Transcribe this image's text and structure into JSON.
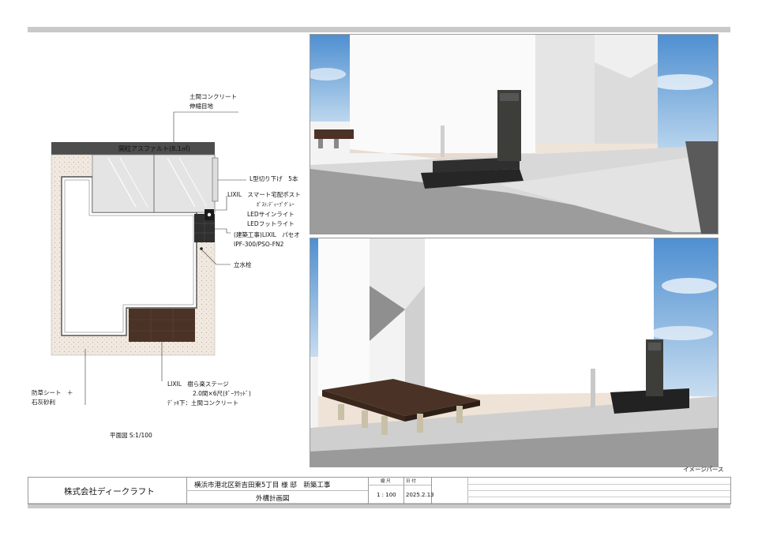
{
  "plan": {
    "asphalt_label": "開粒アスファルト(8.1㎡)",
    "callouts": {
      "concrete": [
        "土間コンクリート",
        "伸縮目地"
      ],
      "lcut": "L型切り下げ　5本",
      "post": [
        "LIXIL　スマート宅配ポスト",
        "ﾎﾟｽﾄ;ﾃﾞｨｰﾌﾟｸﾞﾚｰ",
        "LEDサインライト",
        "LEDフットライト"
      ],
      "paving": [
        "(建築工事)LIXIL　パセオ",
        "IPF-300/PSO-FN2"
      ],
      "faucet": "立水栓",
      "deck": [
        "LIXIL　樹ら楽ステージ",
        "2.0間×6尺(ﾀﾞｰｸｳｯﾄﾞ)",
        "ﾃﾞｯｷ下：土間コンクリート"
      ],
      "gravel": [
        "防草シート　＋",
        "石灰砂利"
      ]
    },
    "scale": "平面図 S:1/100"
  },
  "perspective_caption": "イメージパース",
  "title_block": {
    "company": "株式会社ディークラフト",
    "project": "横浜市港北区新吉田東5丁目 様 邸　新築工事",
    "drawing_name": "外構計画図",
    "scale_header": "縮 尺",
    "date_header": "日 付",
    "scale_value": "1 : 100",
    "date_value": "2025.2.13"
  },
  "colors": {
    "asphalt": "#4d4d4d",
    "deck": "#4a3326",
    "gravel": "#f1e9e0",
    "sky": "#6fa6d9",
    "post": "#3d3d3a",
    "band": "#c9c9c9"
  }
}
